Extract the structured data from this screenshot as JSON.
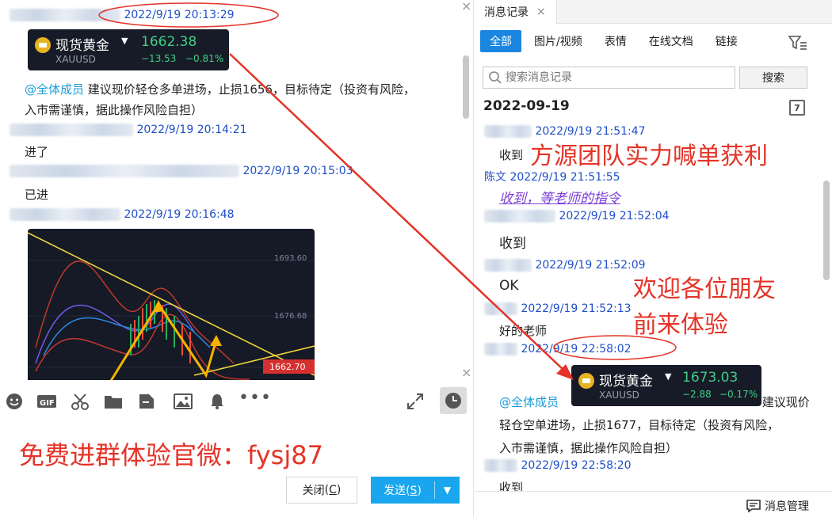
{
  "left": {
    "messages": [
      {
        "time": "2022/9/19 20:13:29"
      },
      {
        "at": "@全体成员",
        "text_line1": "建议现价轻仓多单进场，止损1656，目标待定（投资有风险，",
        "text_line2": "入市需谨慎，据此操作风险自担）"
      },
      {
        "time": "2022/9/19 20:14:21",
        "text": "进了"
      },
      {
        "time": "2022/9/19 20:15:03",
        "text": "已进"
      },
      {
        "time": "2022/9/19 20:16:48"
      }
    ],
    "gold_card": {
      "name": "现货黄金",
      "symbol": "XAUUSD",
      "price": "1662.38",
      "change": "−13.53",
      "pct": "−0.81%"
    },
    "chart": {
      "ticks": [
        "1693.60",
        "1676.68"
      ],
      "price_tag": "1662.70"
    },
    "ad_text": "免费进群体验官微：fysj87",
    "close_btn": {
      "label": "关闭",
      "key": "C"
    },
    "send_btn": {
      "label": "发送",
      "key": "S"
    }
  },
  "right": {
    "tab_title": "消息记录",
    "filters": [
      "全部",
      "图片/视频",
      "表情",
      "在线文档",
      "链接"
    ],
    "search_placeholder": "搜索消息记录",
    "search_btn": "搜索",
    "date": "2022-09-19",
    "cal_num": "7",
    "messages": [
      {
        "time": "2022/9/19 21:51:47",
        "text": "收到"
      },
      {
        "sender": "陈文",
        "time": "2022/9/19 21:51:55",
        "text": "收到，等老师的指令"
      },
      {
        "time": "2022/9/19 21:52:04",
        "text": "收到"
      },
      {
        "time": "2022/9/19 21:52:09",
        "text": "OK"
      },
      {
        "time": "2022/9/19 21:52:13",
        "text": "好的老师"
      },
      {
        "time": "2022/9/19 22:58:02"
      },
      {
        "at": "@全体成员",
        "text_tail": "建议现价",
        "text_line2": "轻仓空单进场，止损1677，目标待定（投资有风险，",
        "text_line3": "入市需谨慎，据此操作风险自担）"
      },
      {
        "time": "2022/9/19 22:58:20",
        "text": "收到"
      }
    ],
    "gold_card": {
      "name": "现货黄金",
      "symbol": "XAUUSD",
      "price": "1673.03",
      "change": "−2.88",
      "pct": "−0.17%"
    },
    "overlay_1": "方源团队实力喊单获利",
    "overlay_2a": "欢迎各位朋友",
    "overlay_2b": "前来体验",
    "manage": "消息管理"
  },
  "colors": {
    "accent": "#1a86e0",
    "red_overlay": "#e53327",
    "gold_green": "#3fcf86"
  }
}
